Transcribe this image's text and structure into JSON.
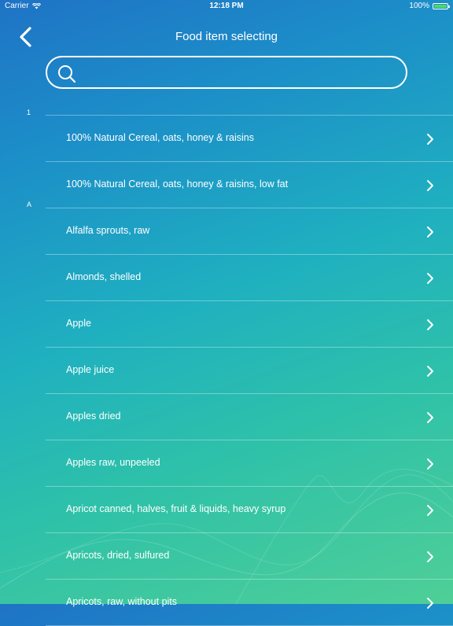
{
  "status_bar": {
    "carrier": "Carrier",
    "time": "12:18 PM",
    "battery": "100%",
    "battery_level": 1.0,
    "wifi_icon": "wifi-icon",
    "battery_icon": "battery-icon"
  },
  "nav": {
    "title": "Food item selecting",
    "back_icon": "chevron-left-icon"
  },
  "search": {
    "value": "",
    "placeholder": "",
    "icon": "search-icon"
  },
  "section_index": [
    "1",
    "A"
  ],
  "colors": {
    "gradient_start": "#1f73c6",
    "gradient_end": "#4fcf97",
    "text": "#ffffff",
    "battery_fill": "#4cd964"
  },
  "items": [
    {
      "label": "100% Natural Cereal, oats, honey & raisins"
    },
    {
      "label": "100% Natural Cereal, oats, honey & raisins, low fat"
    },
    {
      "label": "Alfalfa sprouts, raw"
    },
    {
      "label": "Almonds, shelled"
    },
    {
      "label": "Apple"
    },
    {
      "label": "Apple juice"
    },
    {
      "label": "Apples dried"
    },
    {
      "label": "Apples raw, unpeeled"
    },
    {
      "label": "Apricot canned, halves, fruit & liquids, heavy syrup"
    },
    {
      "label": "Apricots, dried, sulfured"
    },
    {
      "label": "Apricots, raw, without pits"
    }
  ]
}
